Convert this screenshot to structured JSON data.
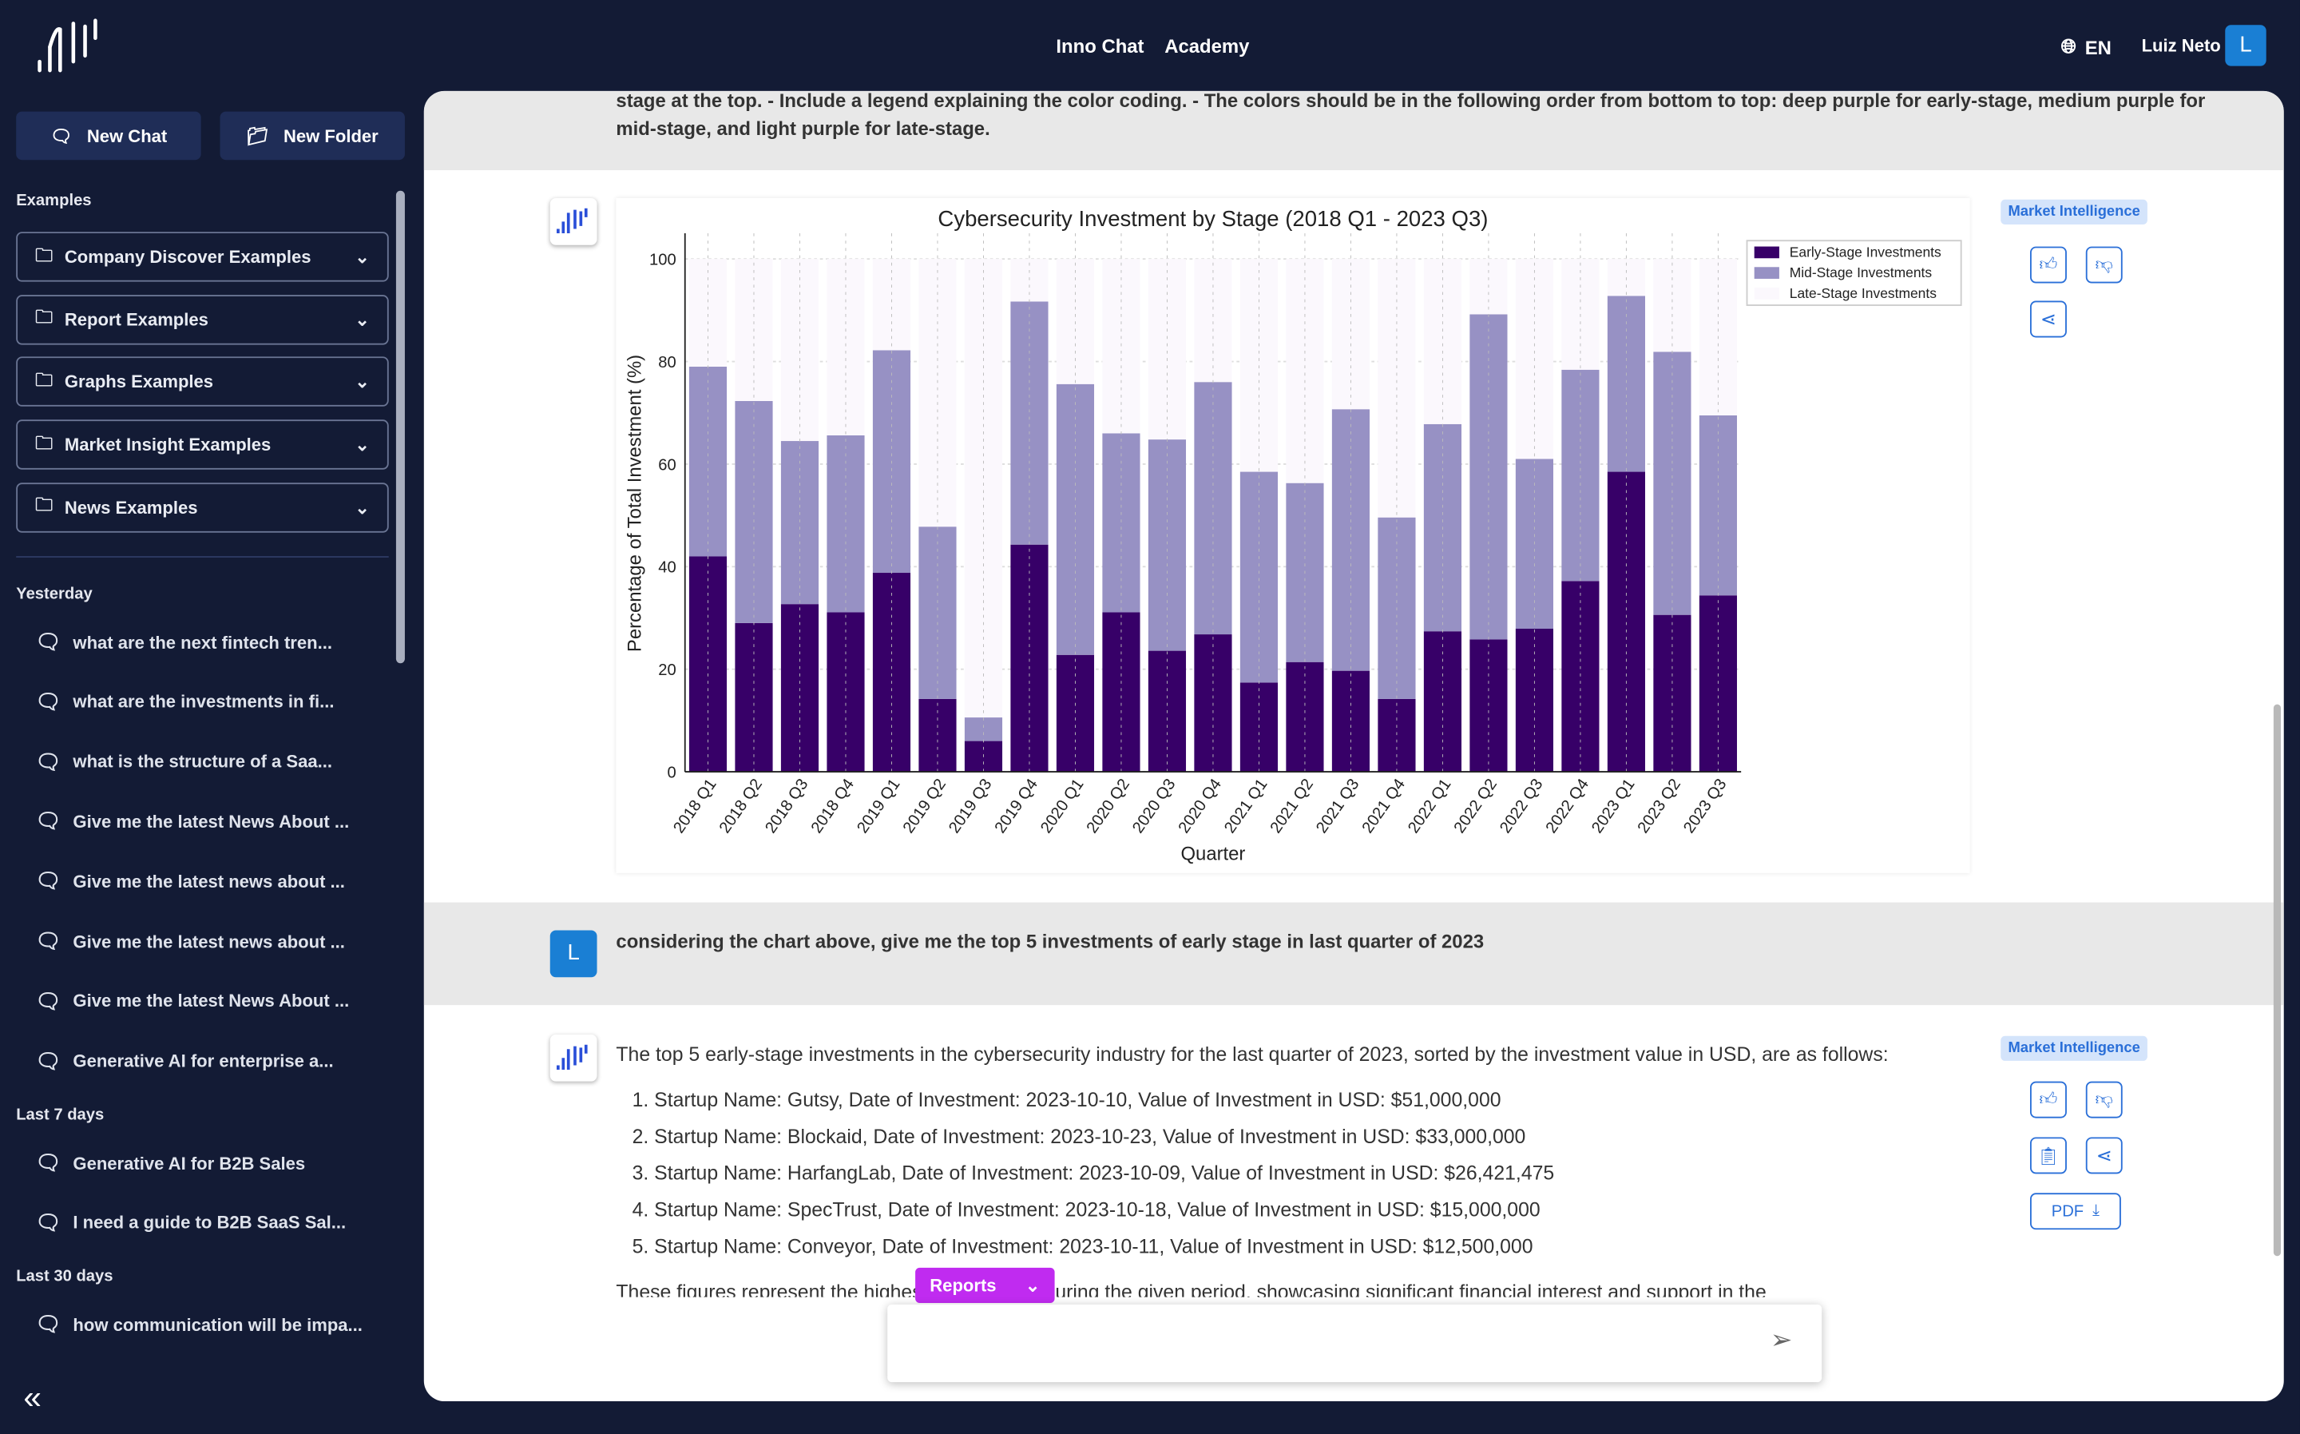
{
  "header": {
    "nav": [
      "Inno Chat",
      "Academy"
    ],
    "language": "EN",
    "user_name": "Luiz Neto",
    "user_initial": "L"
  },
  "sidebar": {
    "new_chat": "New Chat",
    "new_folder": "New Folder",
    "examples_label": "Examples",
    "folders": [
      "Company Discover Examples",
      "Report Examples",
      "Graphs Examples",
      "Market Insight Examples",
      "News Examples"
    ],
    "groups": [
      {
        "label": "Yesterday",
        "items": [
          "what are the next fintech tren...",
          "what are the investments in fi...",
          "what is the structure of a Saa...",
          "Give me the latest News About ...",
          "Give me the latest news about ...",
          "Give me the latest news about ...",
          "Give me the latest News About ...",
          "Generative AI for enterprise a..."
        ]
      },
      {
        "label": "Last 7 days",
        "items": [
          "Generative AI for B2B Sales",
          "I need a guide to B2B SaaS Sal..."
        ]
      },
      {
        "label": "Last 30 days",
        "items": [
          "how communication will be impa..."
        ]
      }
    ]
  },
  "conversation": {
    "prompt_tail": "stage at the top. - Include a legend explaining the color coding. - The colors should be in the following order from bottom to top: deep purple for early-stage, medium purple for mid-stage, and light purple for late-stage.",
    "tag": "Market Intelligence",
    "user_question": "considering the chart above, give me the top 5 investments of early stage in last quarter of 2023",
    "user_initial": "L",
    "answer_intro": "The top 5 early-stage investments in the cybersecurity industry for the last quarter of 2023, sorted by the investment value in USD, are as follows:",
    "answer_items": [
      "Startup Name: Gutsy, Date of Investment: 2023-10-10, Value of Investment in USD: $51,000,000",
      "Startup Name: Blockaid, Date of Investment: 2023-10-23, Value of Investment in USD: $33,000,000",
      "Startup Name: HarfangLab, Date of Investment: 2023-10-09, Value of Investment in USD: $26,421,475",
      "Startup Name: SpecTrust, Date of Investment: 2023-10-18, Value of Investment in USD: $15,000,000",
      "Startup Name: Conveyor, Date of Investment: 2023-10-11, Value of Investment in USD: $12,500,000"
    ],
    "answer_tail": "These figures represent the highest investments during the given period, showcasing significant financial interest and support in the",
    "pdf_label": "PDF",
    "reports_label": "Reports"
  },
  "chart_data": {
    "type": "bar",
    "stacked": true,
    "title": "Cybersecurity Investment by Stage (2018 Q1 - 2023 Q3)",
    "xlabel": "Quarter",
    "ylabel": "Percentage of Total Investment (%)",
    "ylim": [
      0,
      105
    ],
    "yticks": [
      0,
      20,
      40,
      60,
      80,
      100
    ],
    "grid": true,
    "legend_placement": "top-right",
    "categories": [
      "2018 Q1",
      "2018 Q2",
      "2018 Q3",
      "2018 Q4",
      "2019 Q1",
      "2019 Q2",
      "2019 Q3",
      "2019 Q4",
      "2020 Q1",
      "2020 Q2",
      "2020 Q3",
      "2020 Q4",
      "2021 Q1",
      "2021 Q2",
      "2021 Q3",
      "2021 Q4",
      "2022 Q1",
      "2022 Q2",
      "2022 Q3",
      "2022 Q4",
      "2023 Q1",
      "2023 Q2",
      "2023 Q3"
    ],
    "series": [
      {
        "name": "Early-Stage Investments",
        "color": "#370068",
        "values": [
          42,
          29,
          32.7,
          31.1,
          38.8,
          14.2,
          6,
          44.3,
          22.8,
          31.1,
          23.6,
          26.8,
          17.4,
          21.4,
          19.7,
          14.2,
          27.4,
          25.8,
          27.9,
          37.2,
          58.5,
          30.6,
          34.4
        ]
      },
      {
        "name": "Mid-Stage Investments",
        "color": "#9791c4",
        "values": [
          37,
          43.3,
          31.8,
          34.5,
          43.4,
          33.6,
          4.6,
          47.4,
          52.8,
          34.9,
          41.2,
          49.2,
          41.1,
          34.9,
          51,
          35.4,
          40.4,
          63.4,
          33.1,
          41.2,
          34.3,
          51.3,
          35.1
        ]
      },
      {
        "name": "Late-Stage Investments",
        "color": "#fbf8fd",
        "values": [
          21,
          27.7,
          35.5,
          34.4,
          17.8,
          52.2,
          89.4,
          8.3,
          24.4,
          34,
          35.2,
          24,
          41.5,
          43.7,
          29.3,
          50.4,
          32.2,
          10.8,
          39,
          21.6,
          7.2,
          18.1,
          30.5
        ]
      }
    ]
  }
}
